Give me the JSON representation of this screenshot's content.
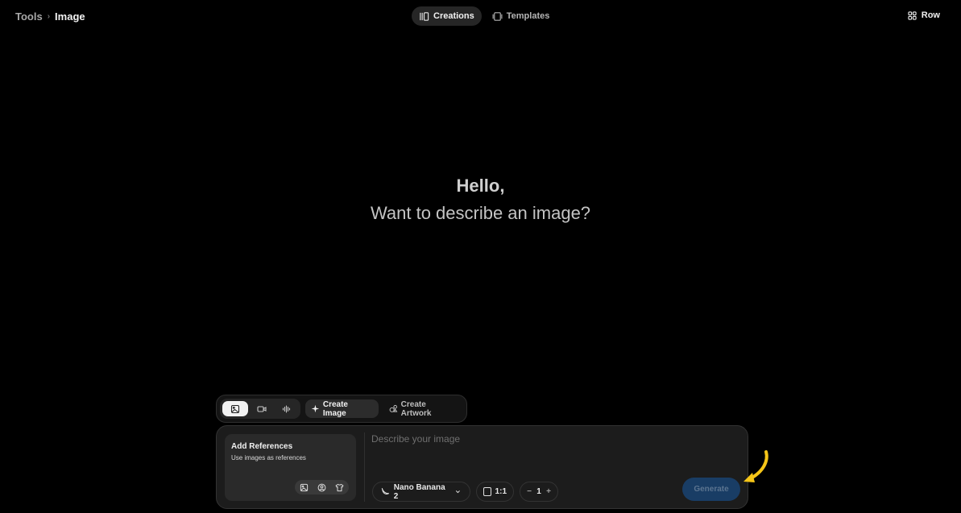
{
  "breadcrumb": {
    "root": "Tools",
    "separator": "›",
    "current": "Image"
  },
  "view_tabs": [
    {
      "label": "Creations",
      "icon": "creations-icon",
      "active": true
    },
    {
      "label": "Templates",
      "icon": "templates-icon",
      "active": false
    }
  ],
  "layout_toggle": {
    "label": "Row",
    "icon": "grid-icon"
  },
  "greeting": {
    "title": "Hello,",
    "subtitle": "Want to describe an image?"
  },
  "mode_bar": {
    "media_types": [
      {
        "name": "image",
        "icon": "image-icon",
        "active": true
      },
      {
        "name": "video",
        "icon": "video-icon",
        "active": false
      },
      {
        "name": "audio",
        "icon": "audio-wave-icon",
        "active": false
      }
    ],
    "modes": [
      {
        "label": "Create Image",
        "icon": "sparkle-icon",
        "active": true
      },
      {
        "label": "Create Artwork",
        "icon": "artwork-icon",
        "active": false
      }
    ]
  },
  "composer": {
    "references": {
      "title": "Add References",
      "subtitle": "Use images as references",
      "icons": [
        "image-icon",
        "person-icon",
        "shirt-icon"
      ]
    },
    "prompt": {
      "placeholder": "Describe your image",
      "value": ""
    },
    "model": {
      "label": "Nano Banana 2",
      "icon": "banana-icon"
    },
    "aspect_ratio": {
      "label": "1:1"
    },
    "count": {
      "value": "1",
      "decrement": "−",
      "increment": "+"
    },
    "generate_label": "Generate"
  },
  "colors": {
    "background": "#000000",
    "panel": "#1c1c1c",
    "accent_generate": "#193d65",
    "annotation_arrow": "#f5c518"
  }
}
